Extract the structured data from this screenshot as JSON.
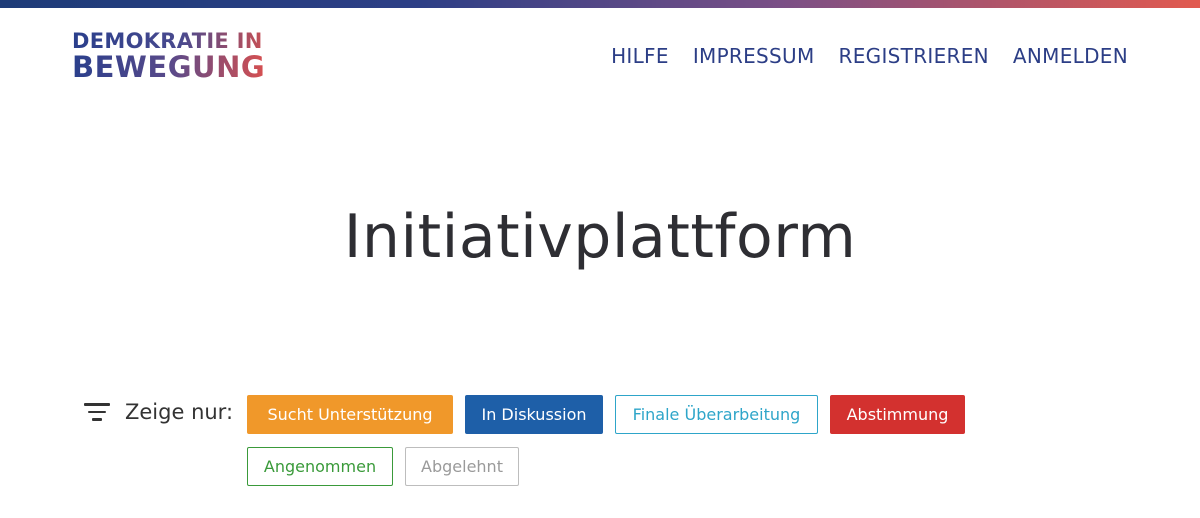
{
  "header": {
    "logo": {
      "line1": "DEMOKRATIE IN",
      "line2": "BEWEGUNG"
    },
    "nav": [
      "HILFE",
      "IMPRESSUM",
      "REGISTRIEREN",
      "ANMELDEN"
    ]
  },
  "main": {
    "title": "Initiativplattform",
    "filter": {
      "label": "Zeige nur:",
      "chips": [
        {
          "label": "Sucht Unterstützung",
          "color": "#f0982a",
          "style": "filled"
        },
        {
          "label": "In Diskussion",
          "color": "#1e5fa8",
          "style": "filled"
        },
        {
          "label": "Finale Überarbeitung",
          "color": "#2ea5c9",
          "style": "outline"
        },
        {
          "label": "Abstimmung",
          "color": "#d3312f",
          "style": "filled"
        },
        {
          "label": "Angenommen",
          "color": "#3a9a3a",
          "style": "outline"
        },
        {
          "label": "Abgelehnt",
          "color": "#9a9a9a",
          "style": "outline"
        }
      ]
    }
  },
  "theme": {
    "gradient_start": "#1e3c78",
    "gradient_end": "#e25a4f",
    "nav_color": "#2c3e86"
  }
}
